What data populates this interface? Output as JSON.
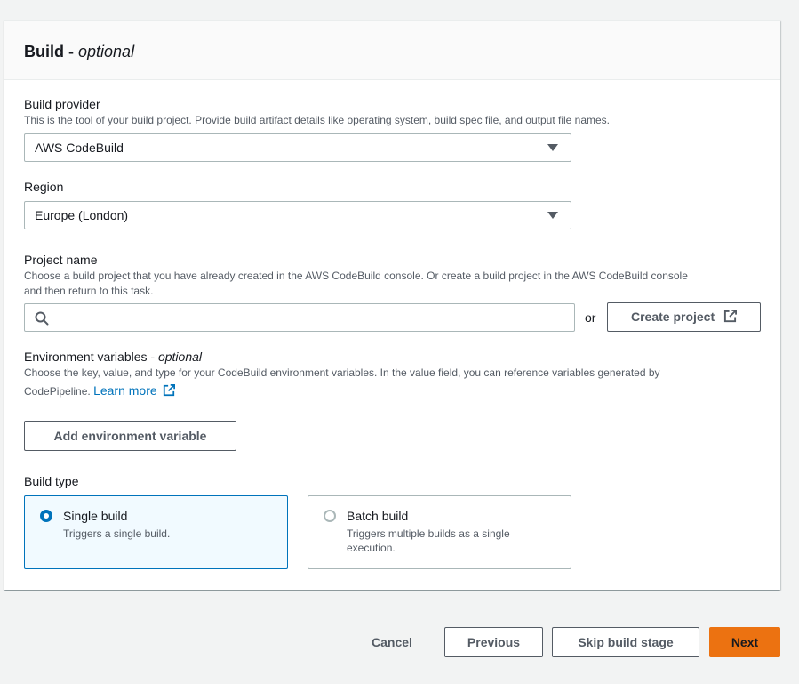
{
  "section": {
    "title": "Build",
    "title_suffix": "optional"
  },
  "build_provider": {
    "label": "Build provider",
    "description": "This is the tool of your build project. Provide build artifact details like operating system, build spec file, and output file names.",
    "value": "AWS CodeBuild"
  },
  "region": {
    "label": "Region",
    "value": "Europe (London)"
  },
  "project_name": {
    "label": "Project name",
    "description_line1": "Choose a build project that you have already created in the AWS CodeBuild console. Or create a build project in the AWS CodeBuild console",
    "description_line2": "and then return to this task.",
    "search_placeholder": "",
    "or_text": "or",
    "create_button": "Create project"
  },
  "env_vars": {
    "label": "Environment variables",
    "label_suffix": "optional",
    "description_line1": "Choose the key, value, and type for your CodeBuild environment variables. In the value field, you can reference variables generated by",
    "description_line2": "CodePipeline.",
    "learn_more": "Learn more",
    "add_button": "Add environment variable"
  },
  "build_type": {
    "label": "Build type",
    "options": [
      {
        "title": "Single build",
        "description": "Triggers a single build.",
        "selected": true
      },
      {
        "title": "Batch build",
        "description": "Triggers multiple builds as a single execution.",
        "selected": false
      }
    ]
  },
  "footer": {
    "cancel": "Cancel",
    "previous": "Previous",
    "skip": "Skip build stage",
    "next": "Next"
  },
  "colors": {
    "accent": "#0073bb",
    "primary_button": "#ec7211",
    "text_secondary": "#545b64"
  },
  "icons": {
    "select_caret": "caret-down-icon",
    "search": "search-icon",
    "external": "external-link-icon"
  }
}
